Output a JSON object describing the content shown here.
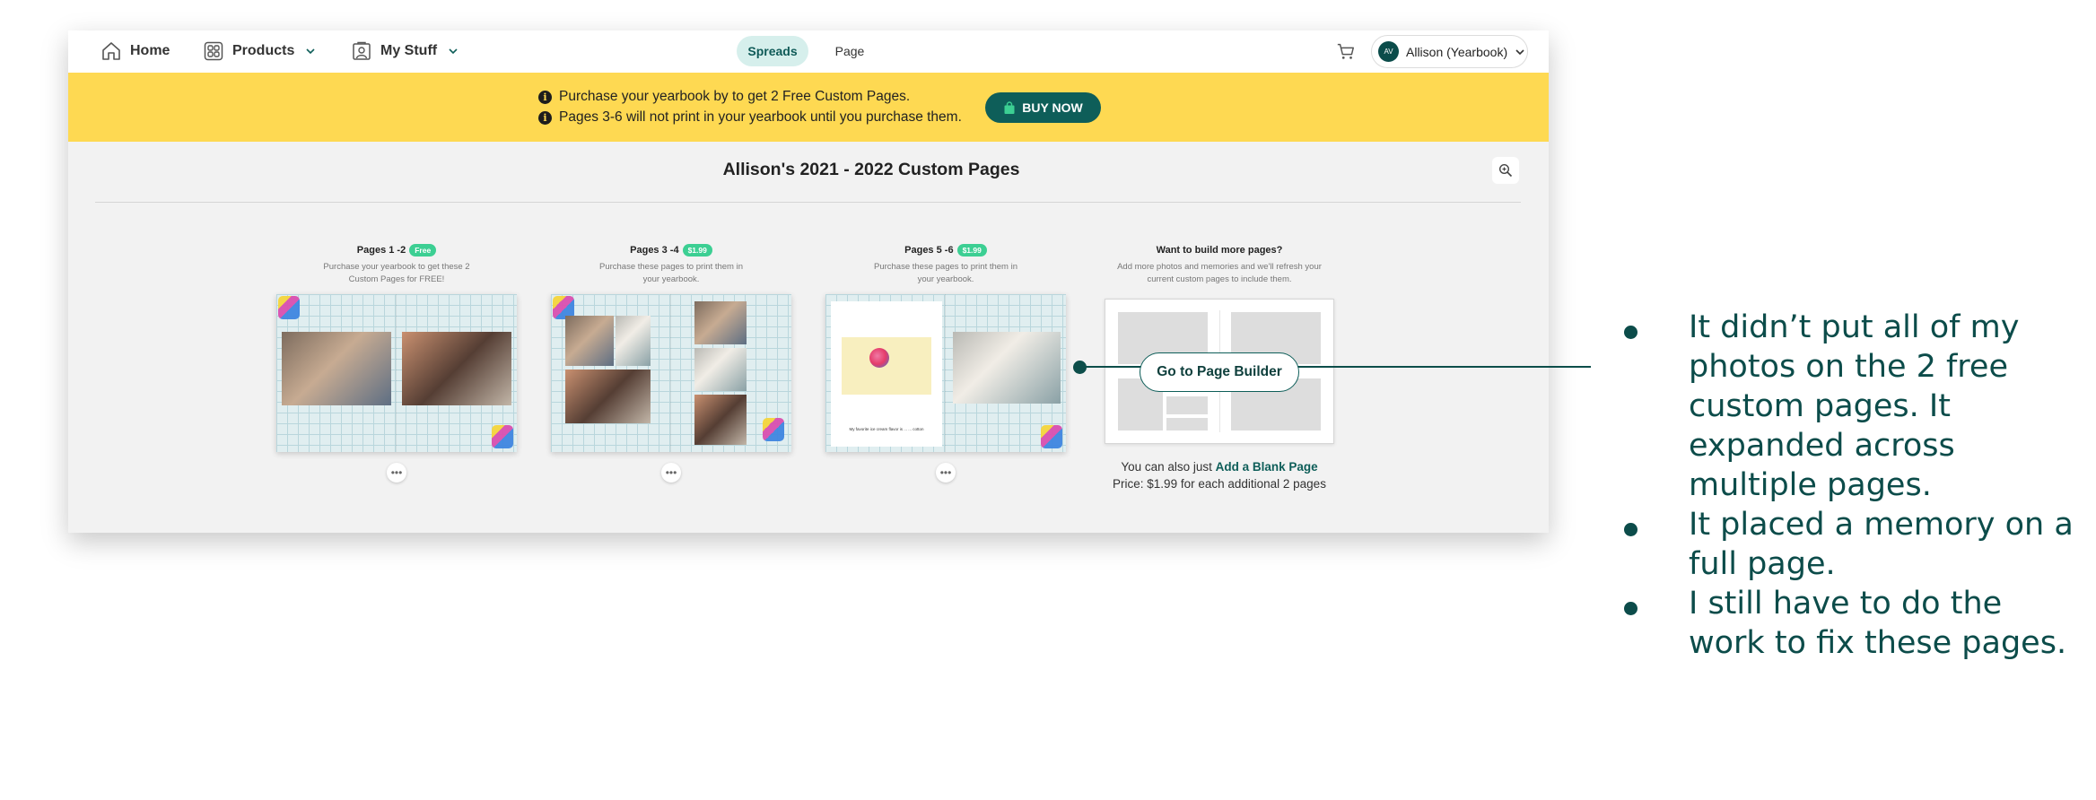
{
  "nav": {
    "home": "Home",
    "products": "Products",
    "my_stuff": "My Stuff",
    "segments": [
      "Spreads",
      "Page"
    ],
    "account": {
      "initials": "AV",
      "name": "Allison (Yearbook)"
    }
  },
  "banner": {
    "line1": "Purchase your yearbook by to get 2 Free Custom Pages.",
    "line2": "Pages 3-6 will not print in your yearbook until you purchase them.",
    "buy_label": "BUY NOW",
    "bg_color": "#fed952",
    "button_color": "#0e5e59"
  },
  "title": "Allison's 2021 - 2022 Custom Pages",
  "spreads": [
    {
      "title": "Pages 1 -2",
      "badge": "Free",
      "desc": "Purchase your yearbook to get these 2 Custom Pages for FREE!",
      "more": "•••"
    },
    {
      "title": "Pages 3 -4",
      "badge": "$1.99",
      "desc": "Purchase these pages to print them in your yearbook.",
      "more": "•••"
    },
    {
      "title": "Pages 5 -6",
      "badge": "$1.99",
      "desc": "Purchase these pages to print them in your yearbook.",
      "more": "•••"
    }
  ],
  "memory_caption": "My favorite ice cream flavor is  ... ... cotton",
  "builder": {
    "title": "Want to build more pages?",
    "desc": "Add more photos and memories and we'll refresh your current custom pages to include them.",
    "button": "Go to Page Builder",
    "blank_prefix": "You can also just ",
    "blank_link": "Add a Blank Page",
    "price": "Price: $1.99 for each additional 2 pages"
  },
  "annotation": {
    "color": "#0c4c4a",
    "bullets": [
      "It didn’t put all of my photos on the 2 free custom pages. It expanded across multiple pages.",
      "It placed a memory on a full page.",
      "I still have to do the work to fix these pages."
    ]
  }
}
